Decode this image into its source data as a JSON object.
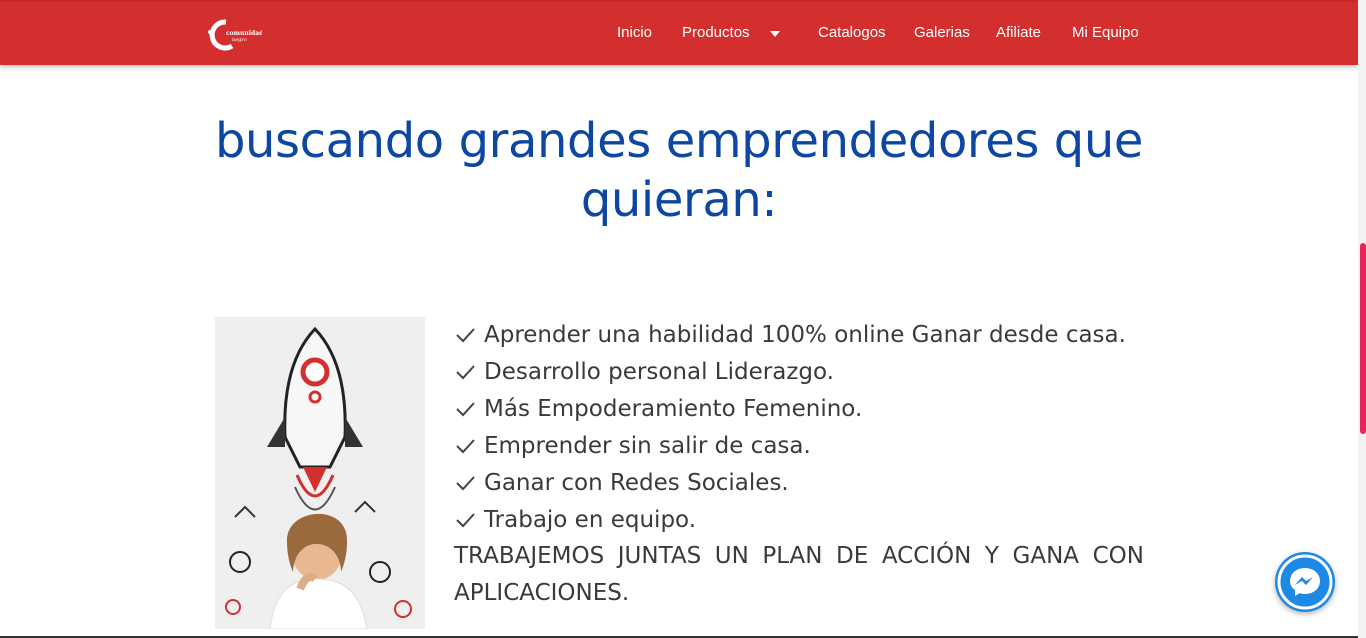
{
  "brand": {
    "logo_text_line1": "comunidad",
    "logo_text_line2": "negro"
  },
  "nav": {
    "items": [
      {
        "label": "Inicio"
      },
      {
        "label": "Productos"
      },
      {
        "label": "Catalogos"
      },
      {
        "label": "Galerias"
      },
      {
        "label": "Afiliate"
      },
      {
        "label": "Mi Equipo"
      }
    ]
  },
  "main": {
    "heading_line1": "buscando grandes emprendedores que",
    "heading_line2": "quieran:",
    "features": [
      "Aprender una habilidad 100% online Ganar desde casa.",
      "Desarrollo personal Liderazgo.",
      "Más Empoderamiento Femenino.",
      "Emprender sin salir de casa.",
      "Ganar con Redes Sociales.",
      "Trabajo en equipo."
    ],
    "cta_words": [
      "TRABAJEMOS",
      "JUNTAS",
      "UN",
      "PLAN",
      "DE",
      "ACCIÓN",
      "Y",
      "GANA",
      "CON"
    ],
    "cta_line2": "APLICACIONES."
  },
  "colors": {
    "navbar": "#d32f2f",
    "heading": "#0d47a1",
    "accent": "#e8245c",
    "messenger": "#1e88e5"
  },
  "icons": {
    "check": "check-icon",
    "caret": "chevron-down-icon",
    "messenger": "messenger-icon"
  }
}
